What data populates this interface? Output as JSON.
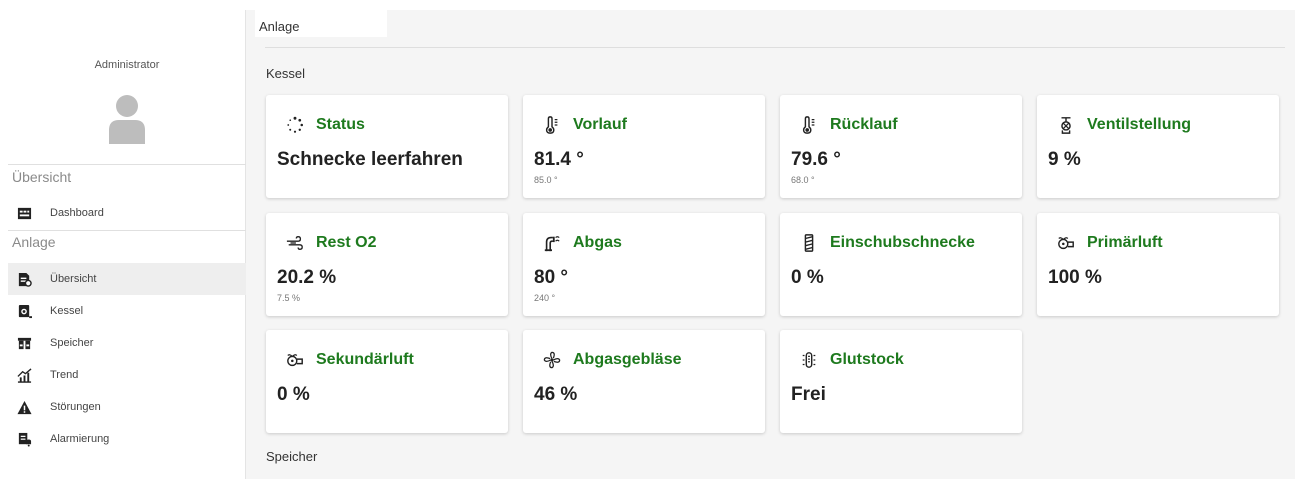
{
  "sidebar": {
    "user": {
      "name": "Administrator"
    },
    "sections": [
      {
        "title": "Übersicht",
        "items": [
          {
            "label": "Dashboard",
            "icon": "dashboard-icon"
          }
        ]
      },
      {
        "title": "Anlage",
        "items": [
          {
            "label": "Übersicht",
            "icon": "overview-icon",
            "active": true
          },
          {
            "label": "Kessel",
            "icon": "boiler-icon"
          },
          {
            "label": "Speicher",
            "icon": "storage-icon"
          },
          {
            "label": "Trend",
            "icon": "trend-icon"
          },
          {
            "label": "Störungen",
            "icon": "warning-icon"
          },
          {
            "label": "Alarmierung",
            "icon": "alarm-icon"
          }
        ]
      }
    ]
  },
  "main": {
    "page_tab": "Anlage",
    "groups": [
      {
        "title": "Kessel"
      },
      {
        "title": "Speicher"
      }
    ],
    "cards": [
      {
        "label": "Status",
        "icon": "status-icon",
        "value": "Schnecke leerfahren",
        "sub": ""
      },
      {
        "label": "Vorlauf",
        "icon": "thermometer-icon",
        "value": "81.4 °",
        "sub": "85.0 °"
      },
      {
        "label": "Rücklauf",
        "icon": "thermometer-icon",
        "value": "79.6 °",
        "sub": "68.0 °"
      },
      {
        "label": "Ventilstellung",
        "icon": "valve-icon",
        "value": "9 %",
        "sub": ""
      },
      {
        "label": "Rest O2",
        "icon": "wind-icon",
        "value": "20.2 %",
        "sub": "7.5 %"
      },
      {
        "label": "Abgas",
        "icon": "exhaust-icon",
        "value": "80 °",
        "sub": "240 °"
      },
      {
        "label": "Einschubschnecke",
        "icon": "screw-icon",
        "value": "0 %",
        "sub": ""
      },
      {
        "label": "Primärluft",
        "icon": "air-icon",
        "value": "100 %",
        "sub": ""
      },
      {
        "label": "Sekundärluft",
        "icon": "air-icon",
        "value": "0 %",
        "sub": ""
      },
      {
        "label": "Abgasgebläse",
        "icon": "fan-icon",
        "value": "46 %",
        "sub": ""
      },
      {
        "label": "Glutstock",
        "icon": "ember-icon",
        "value": "Frei",
        "sub": ""
      }
    ]
  },
  "colors": {
    "accent": "#1e7a1e",
    "active_nav": "#eeeeee",
    "background": "#f5f5f5"
  }
}
